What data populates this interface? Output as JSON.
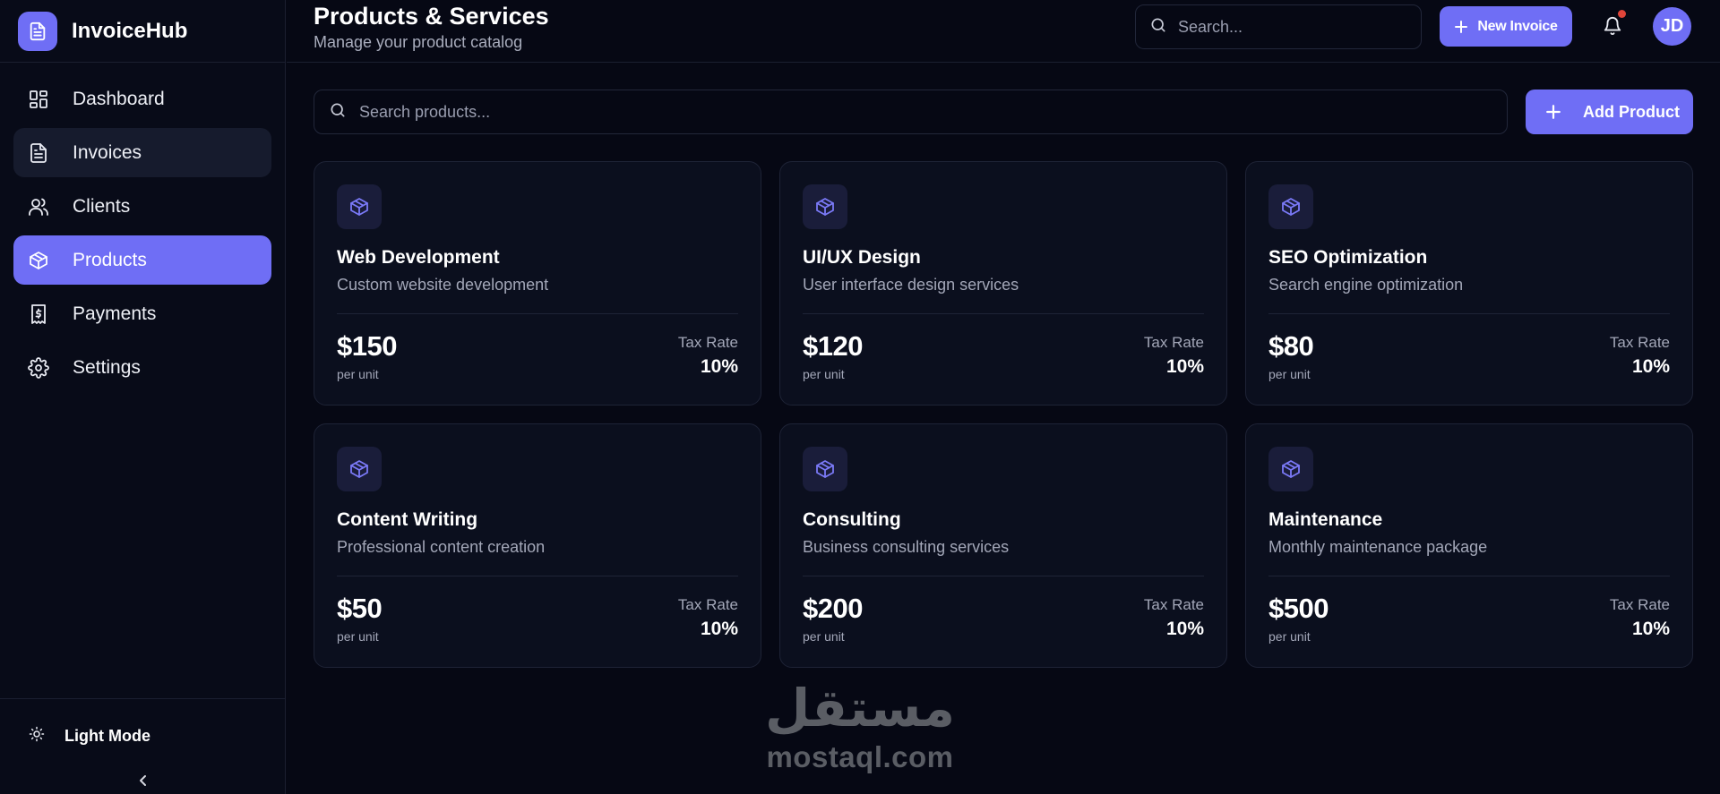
{
  "sidebar": {
    "brand": "InvoiceHub",
    "items": [
      {
        "label": "Dashboard",
        "icon": "dashboard-icon"
      },
      {
        "label": "Invoices",
        "icon": "file-icon"
      },
      {
        "label": "Clients",
        "icon": "users-icon"
      },
      {
        "label": "Products",
        "icon": "box-icon"
      },
      {
        "label": "Payments",
        "icon": "receipt-icon"
      },
      {
        "label": "Settings",
        "icon": "gear-icon"
      }
    ],
    "active": "Products",
    "theme_toggle": "Light Mode"
  },
  "header": {
    "title": "Products & Services",
    "subtitle": "Manage your product catalog",
    "search_placeholder": "Search...",
    "new_invoice": "New Invoice",
    "avatar_initials": "JD"
  },
  "main": {
    "search_placeholder": "Search products...",
    "add_product": "Add Product",
    "tax_label": "Tax Rate",
    "unit_label": "per unit",
    "products": [
      {
        "name": "Web Development",
        "description": "Custom website development",
        "price": "$150",
        "tax": "10%"
      },
      {
        "name": "UI/UX Design",
        "description": "User interface design services",
        "price": "$120",
        "tax": "10%"
      },
      {
        "name": "SEO Optimization",
        "description": "Search engine optimization",
        "price": "$80",
        "tax": "10%"
      },
      {
        "name": "Content Writing",
        "description": "Professional content creation",
        "price": "$50",
        "tax": "10%"
      },
      {
        "name": "Consulting",
        "description": "Business consulting services",
        "price": "$200",
        "tax": "10%"
      },
      {
        "name": "Maintenance",
        "description": "Monthly maintenance package",
        "price": "$500",
        "tax": "10%"
      }
    ]
  },
  "watermark": {
    "text": "mostaql.com",
    "logo": "مستقل"
  },
  "colors": {
    "accent": "#6f6ef5",
    "background": "#060814",
    "card": "#0b0f1e",
    "notification_dot": "#e0453a"
  }
}
